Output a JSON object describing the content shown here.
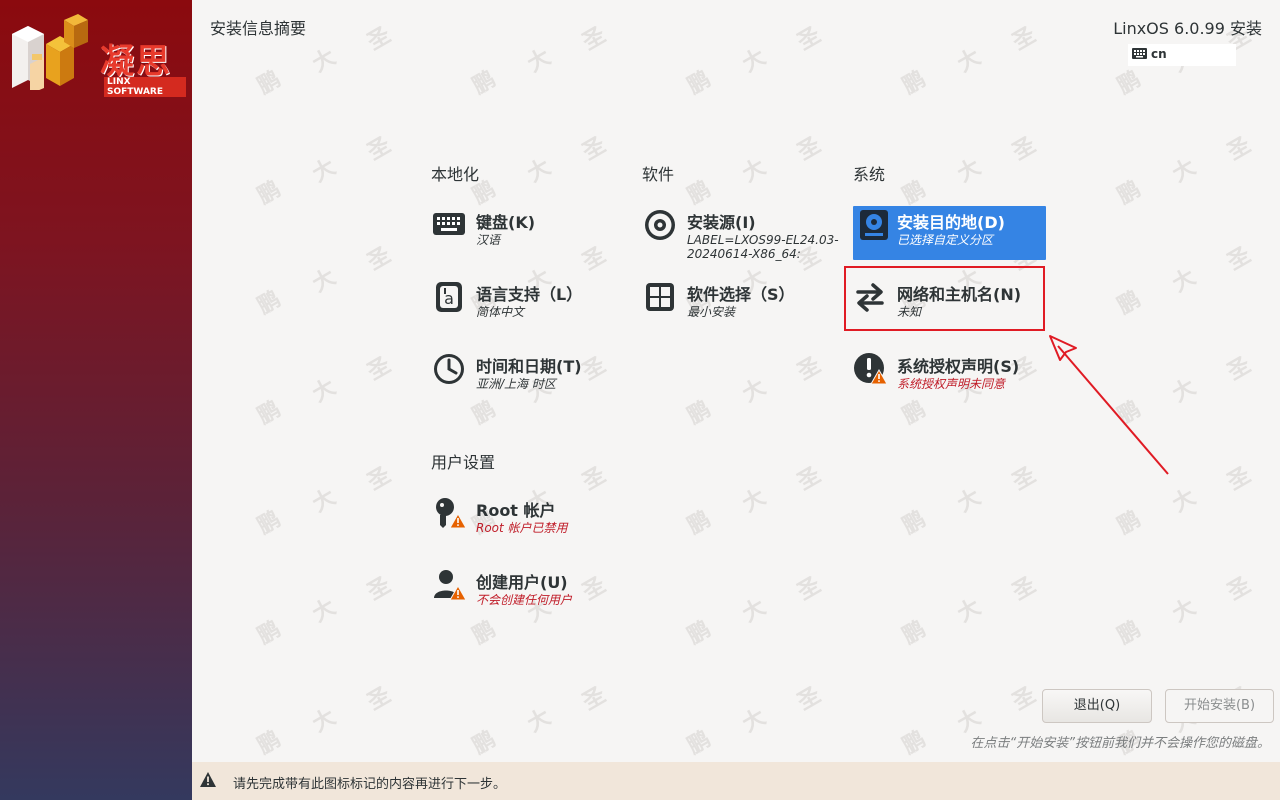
{
  "sidebar": {
    "logo": {
      "brand": "凝思",
      "subtitle": "LINX SOFTWARE"
    }
  },
  "header": {
    "page_title": "安装信息摘要",
    "product_title": "LinxOS 6.0.99 安装",
    "keyboard_layout": "cn"
  },
  "watermark": {
    "chars": [
      "鹏",
      "大",
      "圣"
    ]
  },
  "sections": {
    "localization": {
      "title": "本地化",
      "spokes": [
        {
          "title": "键盘(K)",
          "status": "汉语",
          "icon": "keyboard-icon"
        },
        {
          "title": "语言支持（L）",
          "status": "简体中文",
          "icon": "language-icon"
        },
        {
          "title": "时间和日期(T)",
          "status": "亚洲/上海 时区",
          "icon": "clock-icon"
        }
      ]
    },
    "software": {
      "title": "软件",
      "spokes": [
        {
          "title": "安装源(I)",
          "status": "LABEL=LXOS99-EL24.03-20240614-X86_64:",
          "icon": "disc-icon"
        },
        {
          "title": "软件选择（S）",
          "status": "最小安装",
          "icon": "package-icon"
        }
      ]
    },
    "system": {
      "title": "系统",
      "spokes": [
        {
          "title": "安装目的地(D)",
          "status": "已选择自定义分区",
          "icon": "disk-icon",
          "selected": true
        },
        {
          "title": "网络和主机名(N)",
          "status": "未知",
          "icon": "network-arrows-icon"
        },
        {
          "title": "系统授权声明(S)",
          "status": "系统授权声明未同意",
          "icon": "license-warning-icon",
          "warning": true
        }
      ]
    },
    "user_settings": {
      "title": "用户设置",
      "spokes": [
        {
          "title": "Root 帐户",
          "status": "Root 帐户已禁用",
          "icon": "root-user-icon",
          "warning": true
        },
        {
          "title": "创建用户(U)",
          "status": "不会创建任何用户",
          "icon": "user-icon",
          "warning": true
        }
      ]
    }
  },
  "buttons": {
    "quit": "退出(Q)",
    "begin": "开始安装(B)"
  },
  "hint": "在点击“开始安装”按钮前我们并不会操作您的磁盘。",
  "warning_bar": {
    "message": "请先完成带有此图标标记的内容再进行下一步。"
  },
  "colors": {
    "selected": "#3584e4",
    "warning": "#c01c28",
    "annotation": "#e01b24",
    "warning_bar_bg": "#f1e6da"
  }
}
